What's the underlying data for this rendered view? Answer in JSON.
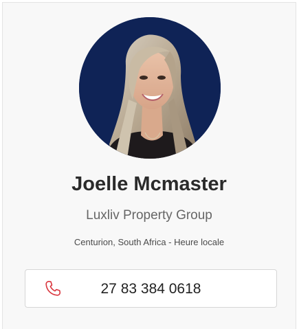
{
  "agent": {
    "name": "Joelle Mcmaster",
    "company": "Luxliv Property Group",
    "location": "Centurion, South Africa - Heure locale",
    "phone": "27 83 384 0618",
    "photo": "agent-portrait"
  },
  "colors": {
    "avatar_background": "#0f2356",
    "phone_icon": "#d9363e",
    "card_background": "#f8f8f8"
  },
  "icons": {
    "phone": "phone-icon"
  }
}
